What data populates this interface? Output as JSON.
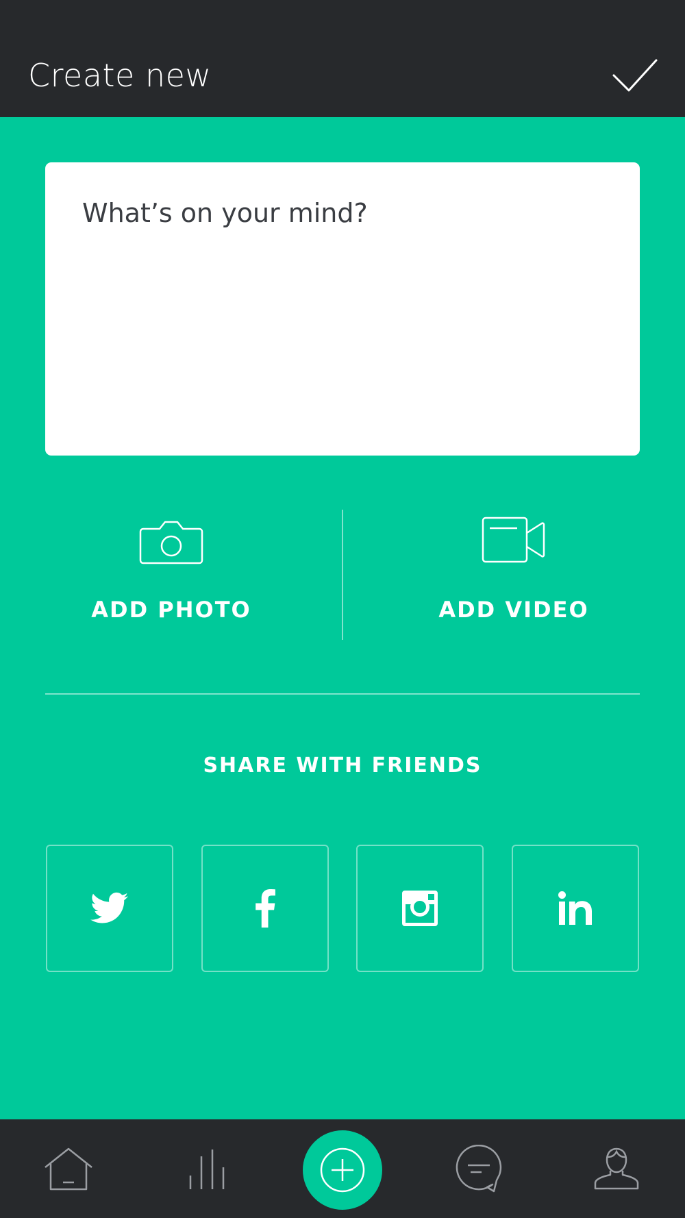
{
  "header": {
    "title": "Create new",
    "confirm_icon": "checkmark-icon"
  },
  "composer": {
    "placeholder": "What’s on your mind?",
    "value": ""
  },
  "media": {
    "photo_label": "ADD PHOTO",
    "photo_icon": "camera-icon",
    "video_label": "ADD VIDEO",
    "video_icon": "video-camera-icon"
  },
  "share": {
    "title": "SHARE WITH FRIENDS",
    "networks": [
      "twitter",
      "facebook",
      "instagram",
      "linkedin"
    ]
  },
  "bottom_nav": {
    "items": [
      "home-icon",
      "stats-icon",
      "add-icon",
      "messages-icon",
      "profile-icon"
    ],
    "active": "add-icon"
  },
  "colors": {
    "accent": "#00c99a",
    "dark": "#27292c",
    "text_dark": "#3a3d42",
    "white": "#ffffff"
  }
}
